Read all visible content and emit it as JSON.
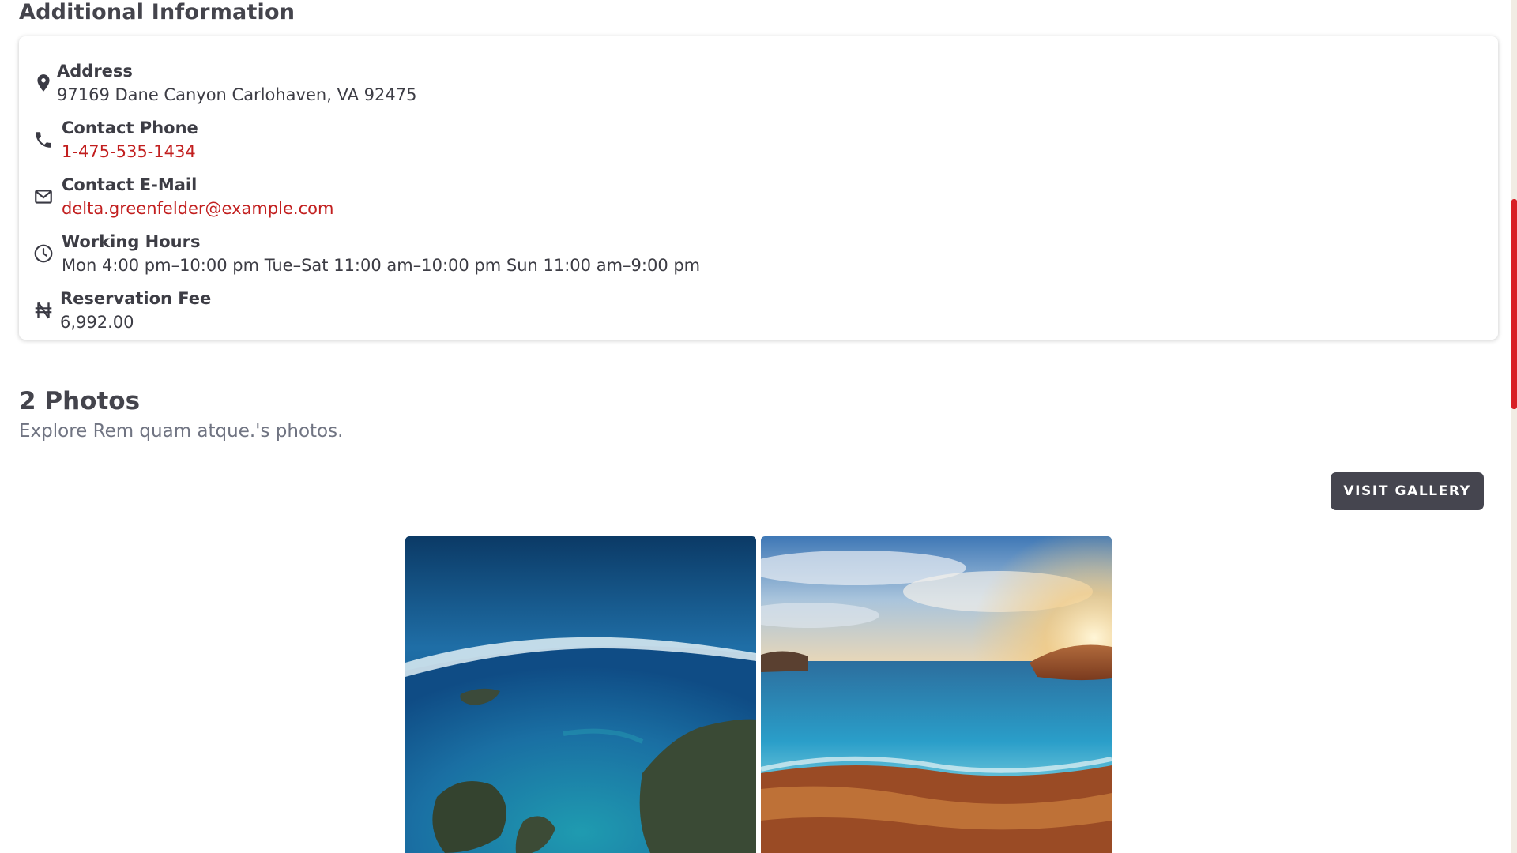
{
  "additional_info": {
    "title": "Additional Information",
    "items": [
      {
        "icon": "location-pin-icon",
        "label": "Address",
        "value": "97169 Dane Canyon Carlohaven, VA 92475"
      },
      {
        "icon": "phone-icon",
        "label": "Contact Phone",
        "value": "1-475-535-1434"
      },
      {
        "icon": "envelope-icon",
        "label": "Contact E-Mail",
        "value": "delta.greenfelder@example.com"
      },
      {
        "icon": "clock-icon",
        "label": "Working Hours",
        "value": "Mon 4:00 pm–10:00 pm Tue–Sat 11:00 am–10:00 pm Sun 11:00 am–9:00 pm"
      },
      {
        "icon": "naira-icon",
        "label": "Reservation Fee",
        "value": "6,992.00"
      }
    ]
  },
  "photos": {
    "title": "2 Photos",
    "subtitle": "Explore Rem quam atque.'s photos.",
    "button_label": "VISIT GALLERY"
  },
  "colors": {
    "accent": "#c21f1f",
    "button": "#45454f",
    "scrollbar_thumb": "#d81f26"
  }
}
